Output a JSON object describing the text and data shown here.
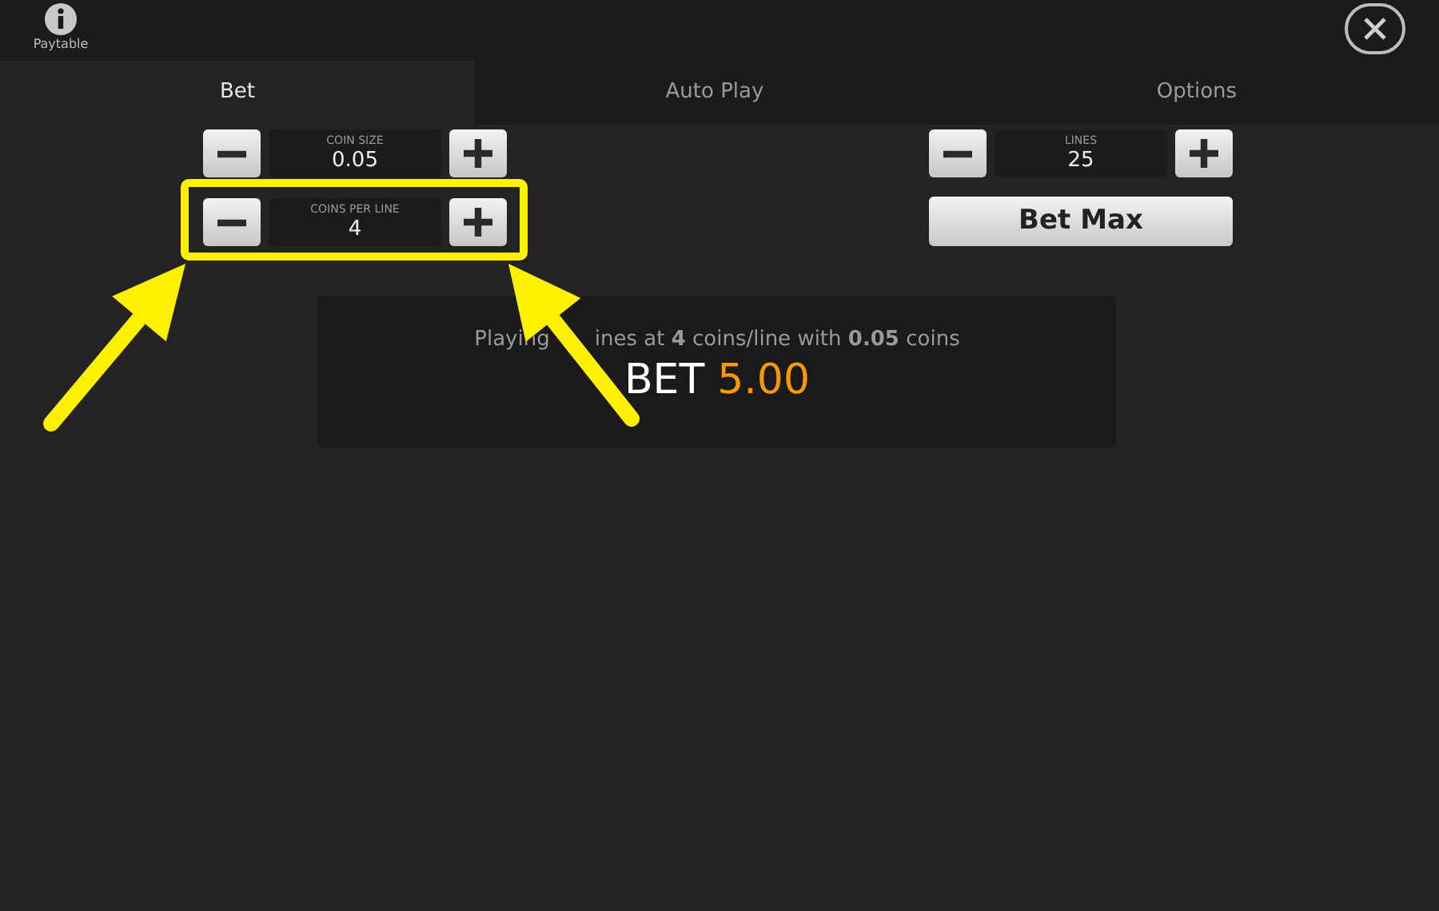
{
  "toolbar": {
    "paytable_label": "Paytable"
  },
  "tabs": [
    {
      "label": "Bet",
      "selected": true
    },
    {
      "label": "Auto Play",
      "selected": false
    },
    {
      "label": "Options",
      "selected": false
    }
  ],
  "steppers": [
    {
      "label": "COIN SIZE",
      "value": "0.05",
      "highlighted": false
    },
    {
      "label": "COINS PER LINE",
      "value": "4",
      "highlighted": true
    },
    {
      "label": "LINES",
      "value": "25",
      "highlighted": false
    }
  ],
  "bet_max_button": "Bet Max",
  "summary": {
    "text_start": "Playing",
    "text_rest": "ines at **4** coins/line with **0.05** coins",
    "bet_label": "BET",
    "bet_value": "5.00"
  }
}
